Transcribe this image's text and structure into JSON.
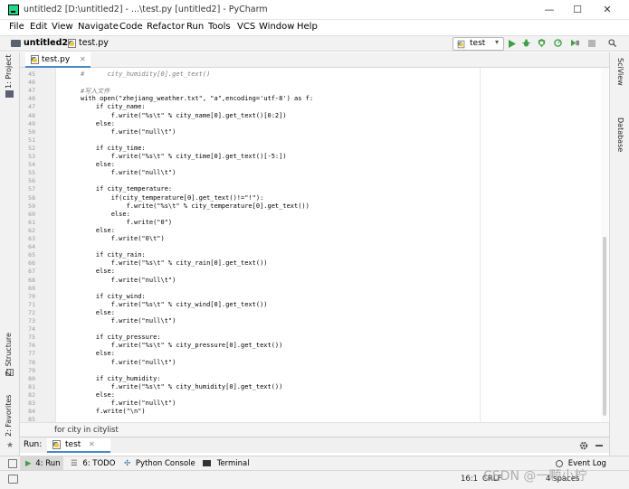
{
  "window": {
    "title": "untitled2 [D:\\untitled2] - ...\\test.py [untitled2] - PyCharm",
    "minimize": "—",
    "maximize": "☐",
    "close": "✕"
  },
  "menu": [
    "File",
    "Edit",
    "View",
    "Navigate",
    "Code",
    "Refactor",
    "Run",
    "Tools",
    "VCS",
    "Window",
    "Help"
  ],
  "nav": {
    "project": "untitled2",
    "file": "test.py",
    "run_config": "test"
  },
  "left_strip": {
    "project": "1: Project",
    "structure": "Z: Structure",
    "favorites": "2: Favorites"
  },
  "right_strip": {
    "sciview": "SciView",
    "database": "Database"
  },
  "editor": {
    "tab": "test.py",
    "lines": [
      {
        "n": "45",
        "t": "#      city_humidity[0].get_text()"
      },
      {
        "n": "46",
        "t": ""
      },
      {
        "n": "47",
        "t": "#写入文件"
      },
      {
        "n": "48",
        "t": "with open(\"zhejiang_weather.txt\", \"a\",encoding='utf-8') as f:"
      },
      {
        "n": "47",
        "t": "    if city_name:"
      },
      {
        "n": "48",
        "t": "        f.write(\"%s\\t\" % city_name[0].get_text()[0:2])"
      },
      {
        "n": "49",
        "t": "    else:"
      },
      {
        "n": "50",
        "t": "        f.write(\"null\\t\")"
      },
      {
        "n": "51",
        "t": ""
      },
      {
        "n": "52",
        "t": "    if city_time:"
      },
      {
        "n": "53",
        "t": "        f.write(\"%s\\t\" % city_time[0].get_text()[-5:])"
      },
      {
        "n": "54",
        "t": "    else:"
      },
      {
        "n": "55",
        "t": "        f.write(\"null\\t\")"
      },
      {
        "n": "56",
        "t": ""
      },
      {
        "n": "57",
        "t": "    if city_temperature:"
      },
      {
        "n": "58",
        "t": "        if(city_temperature[0].get_text()!=\"!\"):"
      },
      {
        "n": "59",
        "t": "            f.write(\"%s\\t\" % city_temperature[0].get_text())"
      },
      {
        "n": "60",
        "t": "        else:"
      },
      {
        "n": "61",
        "t": "            f.write(\"0\")"
      },
      {
        "n": "62",
        "t": "    else:"
      },
      {
        "n": "63",
        "t": "        f.write(\"0\\t\")"
      },
      {
        "n": "64",
        "t": ""
      },
      {
        "n": "65",
        "t": "    if city_rain:"
      },
      {
        "n": "66",
        "t": "        f.write(\"%s\\t\" % city_rain[0].get_text())"
      },
      {
        "n": "67",
        "t": "    else:"
      },
      {
        "n": "68",
        "t": "        f.write(\"null\\t\")"
      },
      {
        "n": "69",
        "t": ""
      },
      {
        "n": "70",
        "t": "    if city_wind:"
      },
      {
        "n": "71",
        "t": "        f.write(\"%s\\t\" % city_wind[0].get_text())"
      },
      {
        "n": "72",
        "t": "    else:"
      },
      {
        "n": "73",
        "t": "        f.write(\"null\\t\")"
      },
      {
        "n": "74",
        "t": ""
      },
      {
        "n": "75",
        "t": "    if city_pressure:"
      },
      {
        "n": "76",
        "t": "        f.write(\"%s\\t\" % city_pressure[0].get_text())"
      },
      {
        "n": "77",
        "t": "    else:"
      },
      {
        "n": "78",
        "t": "        f.write(\"null\\t\")"
      },
      {
        "n": "79",
        "t": ""
      },
      {
        "n": "80",
        "t": "    if city_humidity:"
      },
      {
        "n": "81",
        "t": "        f.write(\"%s\\t\" % city_humidity[0].get_text())"
      },
      {
        "n": "82",
        "t": "    else:"
      },
      {
        "n": "83",
        "t": "        f.write(\"null\\t\")"
      },
      {
        "n": "84",
        "t": "    f.write(\"\\n\")"
      },
      {
        "n": "85",
        "t": ""
      }
    ]
  },
  "breadcrumb": "for city in citylist",
  "run": {
    "label": "Run:",
    "tab": "test"
  },
  "bottom_tabs": {
    "run": "4: Run",
    "todo": "6: TODO",
    "console": "Python Console",
    "terminal": "Terminal",
    "event_log": "Event Log"
  },
  "status": {
    "position": "16:1",
    "line_sep": "CRLF",
    "indent": "4 spaces",
    "watermark": "CSDN @一颗小柠"
  }
}
